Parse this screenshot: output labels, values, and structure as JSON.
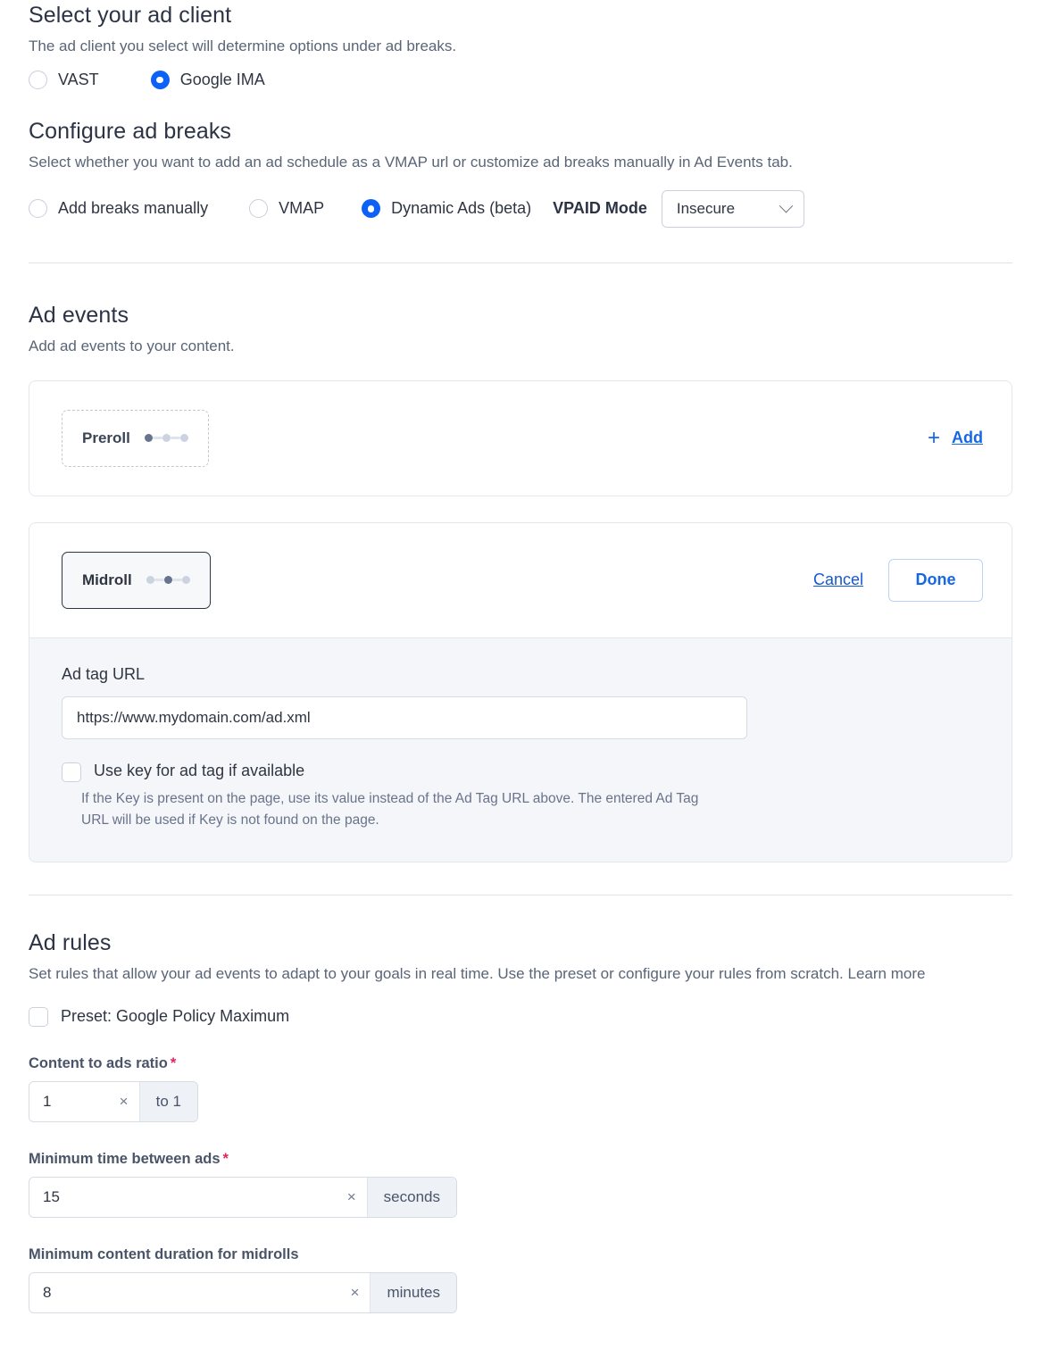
{
  "ad_client": {
    "title": "Select your ad client",
    "description": "The ad client you select will determine options under ad breaks.",
    "options": [
      {
        "label": "VAST",
        "selected": false
      },
      {
        "label": "Google IMA",
        "selected": true
      }
    ]
  },
  "ad_breaks": {
    "title": "Configure ad breaks",
    "description": "Select whether you want to add an ad schedule as a VMAP url or customize ad breaks manually in Ad Events tab.",
    "options": [
      {
        "label": "Add breaks manually",
        "selected": false
      },
      {
        "label": "VMAP",
        "selected": false
      },
      {
        "label": "Dynamic Ads (beta)",
        "selected": true
      }
    ],
    "vpaid_label": "VPAID Mode",
    "vpaid_value": "Insecure"
  },
  "ad_events": {
    "title": "Ad events",
    "description": "Add ad events to your content.",
    "preroll": {
      "chip_label": "Preroll",
      "add_plus": "+",
      "add_label": "Add"
    },
    "midroll": {
      "chip_label": "Midroll",
      "cancel_label": "Cancel",
      "done_label": "Done",
      "ad_tag_label": "Ad tag URL",
      "ad_tag_value": "https://www.mydomain.com/ad.xml",
      "ad_tag_placeholder": "https://www.mydomain.com/ad.xml",
      "use_key_label": "Use key for ad tag if available",
      "use_key_help": "If the Key is present on the page, use its value instead of the Ad Tag URL above. The entered Ad Tag URL will be used if Key is not found on the page.",
      "use_key_checked": false
    }
  },
  "ad_rules": {
    "title": "Ad rules",
    "description": "Set rules that allow your ad events to adapt to your goals in real time. Use the preset or configure your rules from scratch. Learn more",
    "preset_label": "Preset: Google Policy Maximum",
    "preset_checked": false,
    "fields": [
      {
        "label": "Content to ads ratio",
        "required": true,
        "value": "1",
        "clear_icon": "×",
        "suffix": "to 1"
      },
      {
        "label": "Minimum time between ads",
        "required": true,
        "value": "15",
        "clear_icon": "×",
        "suffix": "seconds"
      },
      {
        "label": "Minimum content duration for midrolls",
        "required": false,
        "value": "8",
        "clear_icon": "×",
        "suffix": "minutes"
      }
    ],
    "required_marker": "*"
  },
  "colors": {
    "accent_blue": "#0b62f5",
    "link_blue": "#1667e8",
    "required_red": "#e0245e",
    "heading": "#2c3345"
  }
}
